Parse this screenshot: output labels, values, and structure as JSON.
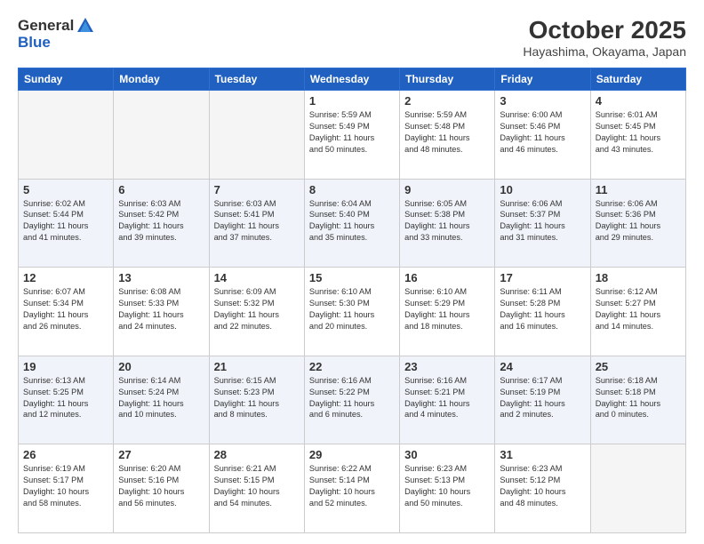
{
  "logo": {
    "general": "General",
    "blue": "Blue"
  },
  "header": {
    "month": "October 2025",
    "location": "Hayashima, Okayama, Japan"
  },
  "weekdays": [
    "Sunday",
    "Monday",
    "Tuesday",
    "Wednesday",
    "Thursday",
    "Friday",
    "Saturday"
  ],
  "weeks": [
    [
      {
        "day": "",
        "info": ""
      },
      {
        "day": "",
        "info": ""
      },
      {
        "day": "",
        "info": ""
      },
      {
        "day": "1",
        "info": "Sunrise: 5:59 AM\nSunset: 5:49 PM\nDaylight: 11 hours\nand 50 minutes."
      },
      {
        "day": "2",
        "info": "Sunrise: 5:59 AM\nSunset: 5:48 PM\nDaylight: 11 hours\nand 48 minutes."
      },
      {
        "day": "3",
        "info": "Sunrise: 6:00 AM\nSunset: 5:46 PM\nDaylight: 11 hours\nand 46 minutes."
      },
      {
        "day": "4",
        "info": "Sunrise: 6:01 AM\nSunset: 5:45 PM\nDaylight: 11 hours\nand 43 minutes."
      }
    ],
    [
      {
        "day": "5",
        "info": "Sunrise: 6:02 AM\nSunset: 5:44 PM\nDaylight: 11 hours\nand 41 minutes."
      },
      {
        "day": "6",
        "info": "Sunrise: 6:03 AM\nSunset: 5:42 PM\nDaylight: 11 hours\nand 39 minutes."
      },
      {
        "day": "7",
        "info": "Sunrise: 6:03 AM\nSunset: 5:41 PM\nDaylight: 11 hours\nand 37 minutes."
      },
      {
        "day": "8",
        "info": "Sunrise: 6:04 AM\nSunset: 5:40 PM\nDaylight: 11 hours\nand 35 minutes."
      },
      {
        "day": "9",
        "info": "Sunrise: 6:05 AM\nSunset: 5:38 PM\nDaylight: 11 hours\nand 33 minutes."
      },
      {
        "day": "10",
        "info": "Sunrise: 6:06 AM\nSunset: 5:37 PM\nDaylight: 11 hours\nand 31 minutes."
      },
      {
        "day": "11",
        "info": "Sunrise: 6:06 AM\nSunset: 5:36 PM\nDaylight: 11 hours\nand 29 minutes."
      }
    ],
    [
      {
        "day": "12",
        "info": "Sunrise: 6:07 AM\nSunset: 5:34 PM\nDaylight: 11 hours\nand 26 minutes."
      },
      {
        "day": "13",
        "info": "Sunrise: 6:08 AM\nSunset: 5:33 PM\nDaylight: 11 hours\nand 24 minutes."
      },
      {
        "day": "14",
        "info": "Sunrise: 6:09 AM\nSunset: 5:32 PM\nDaylight: 11 hours\nand 22 minutes."
      },
      {
        "day": "15",
        "info": "Sunrise: 6:10 AM\nSunset: 5:30 PM\nDaylight: 11 hours\nand 20 minutes."
      },
      {
        "day": "16",
        "info": "Sunrise: 6:10 AM\nSunset: 5:29 PM\nDaylight: 11 hours\nand 18 minutes."
      },
      {
        "day": "17",
        "info": "Sunrise: 6:11 AM\nSunset: 5:28 PM\nDaylight: 11 hours\nand 16 minutes."
      },
      {
        "day": "18",
        "info": "Sunrise: 6:12 AM\nSunset: 5:27 PM\nDaylight: 11 hours\nand 14 minutes."
      }
    ],
    [
      {
        "day": "19",
        "info": "Sunrise: 6:13 AM\nSunset: 5:25 PM\nDaylight: 11 hours\nand 12 minutes."
      },
      {
        "day": "20",
        "info": "Sunrise: 6:14 AM\nSunset: 5:24 PM\nDaylight: 11 hours\nand 10 minutes."
      },
      {
        "day": "21",
        "info": "Sunrise: 6:15 AM\nSunset: 5:23 PM\nDaylight: 11 hours\nand 8 minutes."
      },
      {
        "day": "22",
        "info": "Sunrise: 6:16 AM\nSunset: 5:22 PM\nDaylight: 11 hours\nand 6 minutes."
      },
      {
        "day": "23",
        "info": "Sunrise: 6:16 AM\nSunset: 5:21 PM\nDaylight: 11 hours\nand 4 minutes."
      },
      {
        "day": "24",
        "info": "Sunrise: 6:17 AM\nSunset: 5:19 PM\nDaylight: 11 hours\nand 2 minutes."
      },
      {
        "day": "25",
        "info": "Sunrise: 6:18 AM\nSunset: 5:18 PM\nDaylight: 11 hours\nand 0 minutes."
      }
    ],
    [
      {
        "day": "26",
        "info": "Sunrise: 6:19 AM\nSunset: 5:17 PM\nDaylight: 10 hours\nand 58 minutes."
      },
      {
        "day": "27",
        "info": "Sunrise: 6:20 AM\nSunset: 5:16 PM\nDaylight: 10 hours\nand 56 minutes."
      },
      {
        "day": "28",
        "info": "Sunrise: 6:21 AM\nSunset: 5:15 PM\nDaylight: 10 hours\nand 54 minutes."
      },
      {
        "day": "29",
        "info": "Sunrise: 6:22 AM\nSunset: 5:14 PM\nDaylight: 10 hours\nand 52 minutes."
      },
      {
        "day": "30",
        "info": "Sunrise: 6:23 AM\nSunset: 5:13 PM\nDaylight: 10 hours\nand 50 minutes."
      },
      {
        "day": "31",
        "info": "Sunrise: 6:23 AM\nSunset: 5:12 PM\nDaylight: 10 hours\nand 48 minutes."
      },
      {
        "day": "",
        "info": ""
      }
    ]
  ]
}
